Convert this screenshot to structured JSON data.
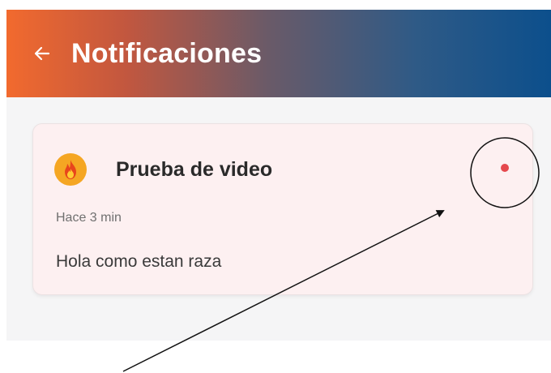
{
  "header": {
    "title": "Notificaciones",
    "back_icon": "arrow-left-icon",
    "gradient_colors": [
      "#f26a2e",
      "#6a5a68",
      "#0c4f8c"
    ]
  },
  "notification": {
    "title": "Prueba de video",
    "time": "Hace 3 min",
    "message": "Hola como estan raza",
    "icon": "fire-icon",
    "unread": true,
    "unread_color": "#e5484d",
    "card_color": "#fdf0f1"
  },
  "annotation": {
    "shapes": [
      "circle",
      "arrow"
    ],
    "color": "#111111"
  }
}
